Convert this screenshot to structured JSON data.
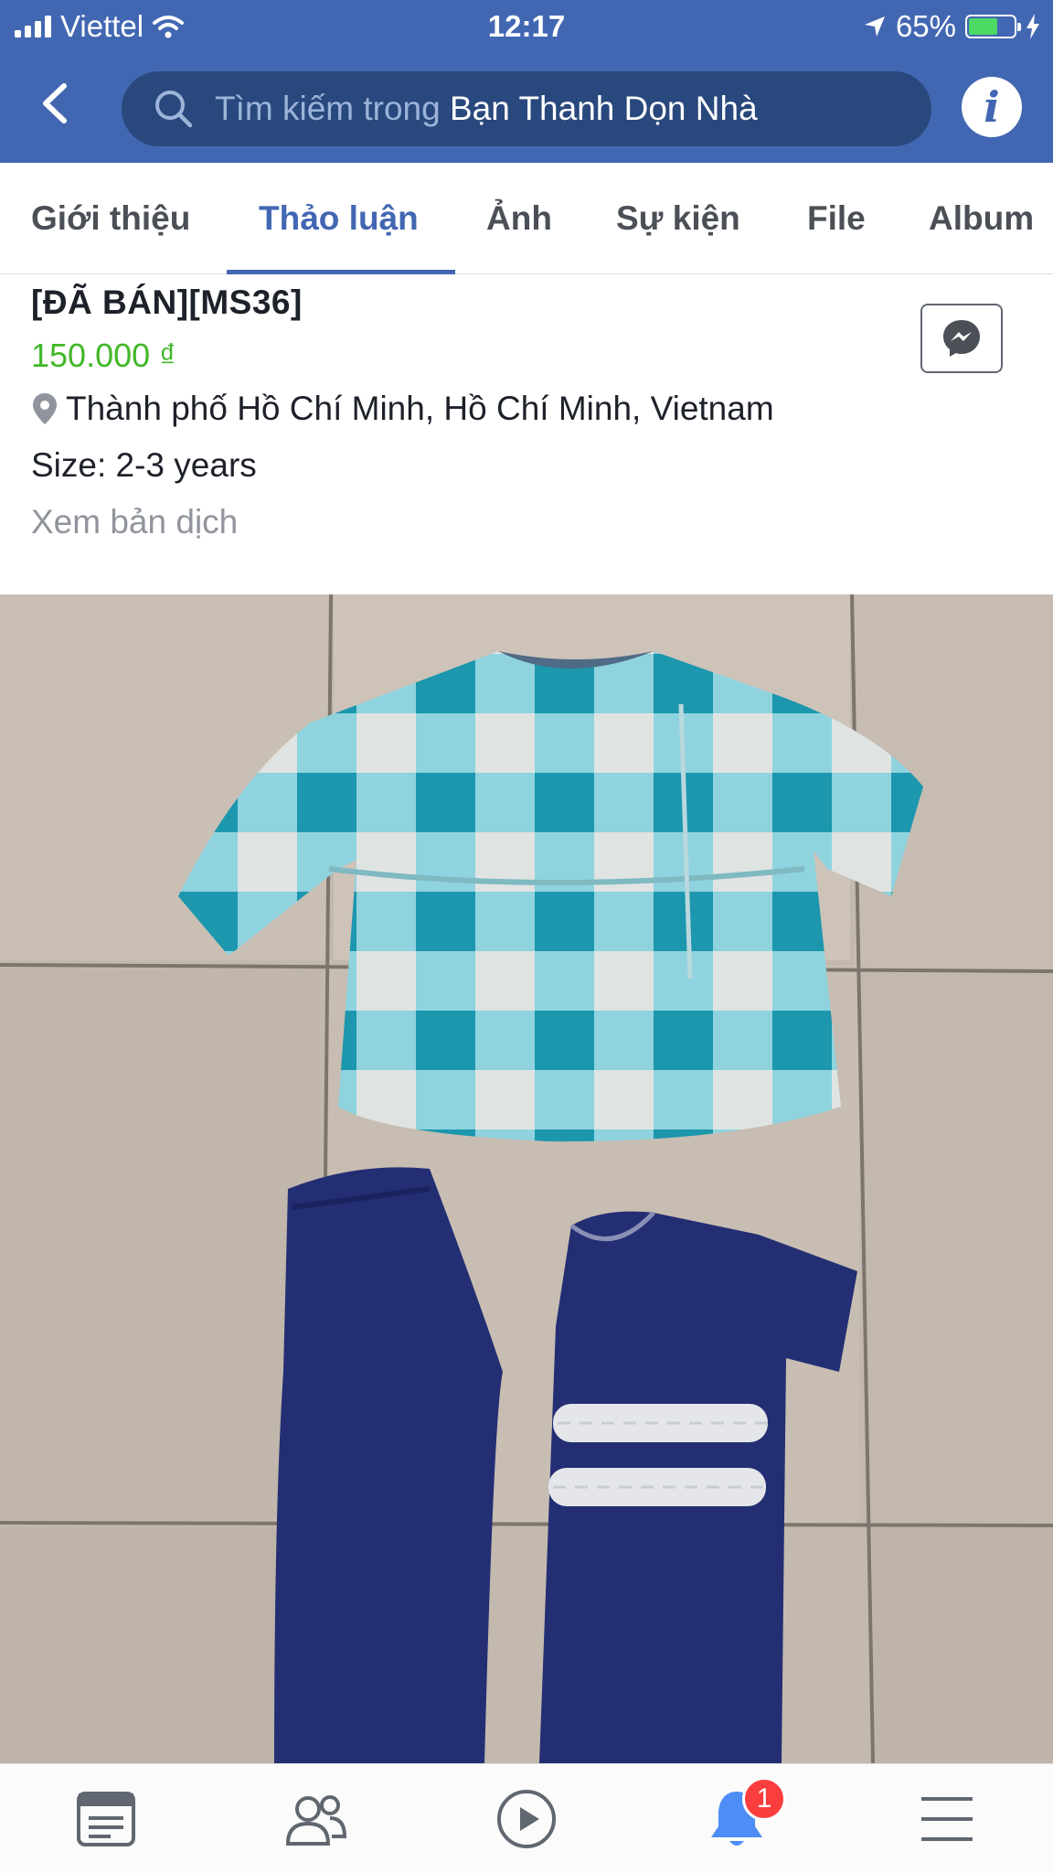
{
  "status_bar": {
    "carrier": "Viettel",
    "time": "12:17",
    "battery": "65%",
    "battery_level": 0.65
  },
  "search": {
    "prefix": "Tìm kiếm trong",
    "group_name": "Bạn Thanh Dọn Nhà"
  },
  "tabs": [
    {
      "label": "Giới thiệu",
      "active": false
    },
    {
      "label": "Thảo luận",
      "active": true
    },
    {
      "label": "Ảnh",
      "active": false
    },
    {
      "label": "Sự kiện",
      "active": false
    },
    {
      "label": "File",
      "active": false
    },
    {
      "label": "Album",
      "active": false
    }
  ],
  "post": {
    "title": "[ĐÃ BÁN][MS36]",
    "price": "150.000 ₫",
    "location": "Thành phố Hồ Chí Minh, Hồ Chí Minh, Vietnam",
    "size": "Size: 2-3 years",
    "translate": "Xem bản dịch"
  },
  "bottom_nav": {
    "items": [
      "news-feed-icon",
      "groups-icon",
      "watch-icon",
      "notifications-icon",
      "menu-icon"
    ],
    "notification_count": "1"
  },
  "colors": {
    "header": "#4267b2",
    "search_bg": "#29487d",
    "price": "#42b72a",
    "active_tab": "#4267b2",
    "badge": "#fa3e3e"
  }
}
